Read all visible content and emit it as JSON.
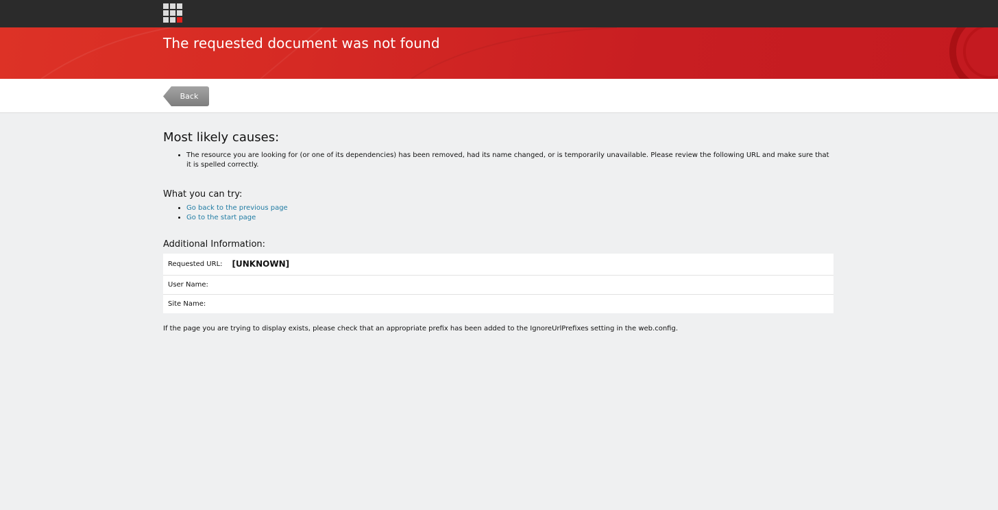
{
  "banner": {
    "title": "The requested document was not found"
  },
  "toolbar": {
    "back_label": "Back"
  },
  "causes": {
    "heading": "Most likely causes:",
    "items": [
      "The resource you are looking for (or one of its dependencies) has been removed, had its name changed, or is temporarily unavailable. Please review the following URL and make sure that it is spelled correctly."
    ]
  },
  "try": {
    "heading": "What you can try:",
    "links": [
      "Go back to the previous page",
      "Go to the start page"
    ]
  },
  "info": {
    "heading": "Additional Information:",
    "rows": [
      {
        "label": "Requested URL:",
        "value": "[UNKNOWN]"
      },
      {
        "label": "User Name:",
        "value": ""
      },
      {
        "label": "Site Name:",
        "value": ""
      }
    ]
  },
  "note": "If the page you are trying to display exists, please check that an appropriate prefix has been added to the IgnoreUrlPrefixes setting in the web.config.",
  "colors": {
    "accent_red": "#d62a24",
    "topbar": "#2b2b2b",
    "link": "#1f7ba3"
  }
}
